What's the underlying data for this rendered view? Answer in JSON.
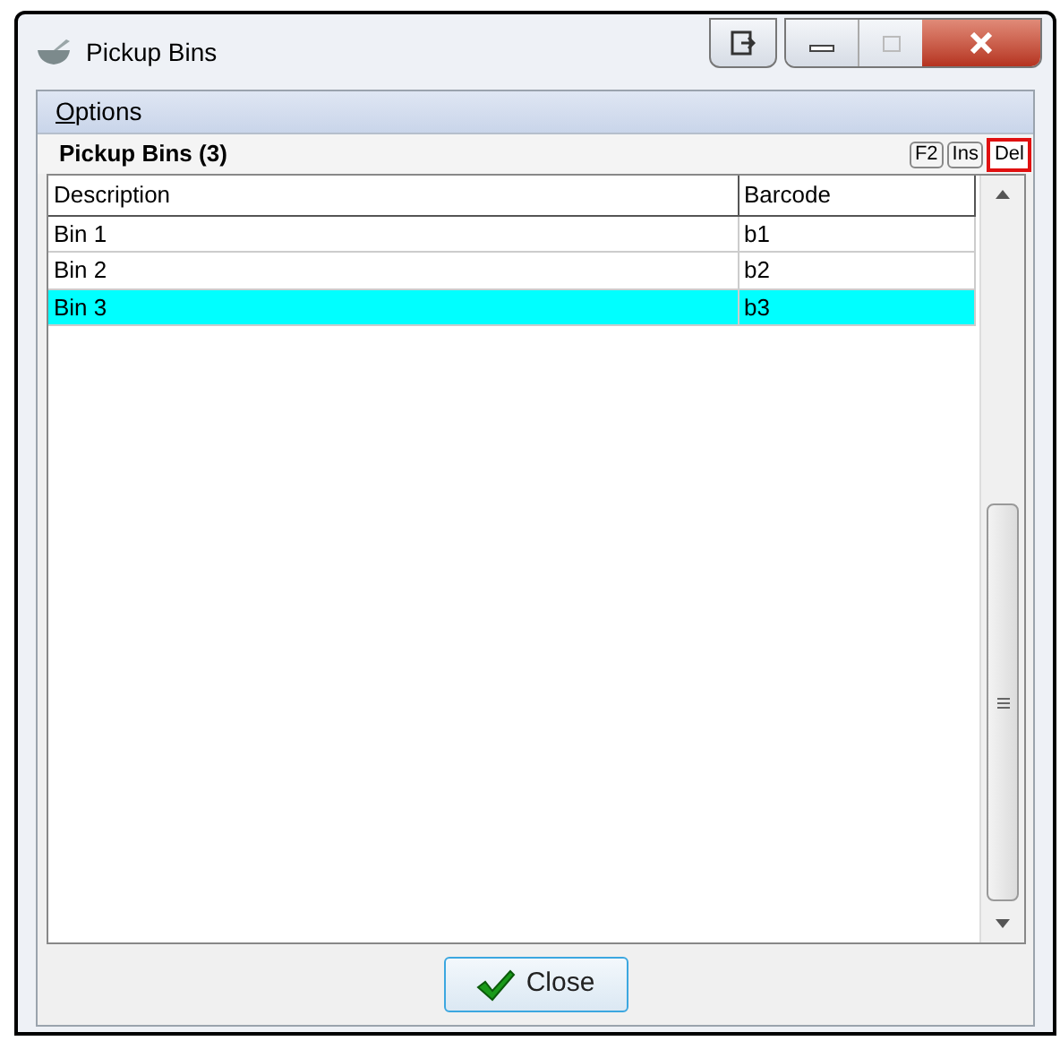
{
  "window": {
    "title": "Pickup Bins"
  },
  "menu": [
    {
      "label": "Options",
      "mnemonic": true
    }
  ],
  "panel": {
    "title": "Pickup Bins (3)",
    "keys": [
      {
        "label": "F2",
        "highlighted": false
      },
      {
        "label": "Ins",
        "highlighted": false
      },
      {
        "label": "Del",
        "highlighted": true
      }
    ]
  },
  "table": {
    "columns": [
      "Description",
      "Barcode"
    ],
    "rows": [
      {
        "cells": [
          "Bin 1",
          "b1"
        ],
        "selected": false
      },
      {
        "cells": [
          "Bin 2",
          "b2"
        ],
        "selected": false
      },
      {
        "cells": [
          "Bin 3",
          "b3"
        ],
        "selected": true
      }
    ]
  },
  "buttons": [
    {
      "label": "Close"
    }
  ]
}
